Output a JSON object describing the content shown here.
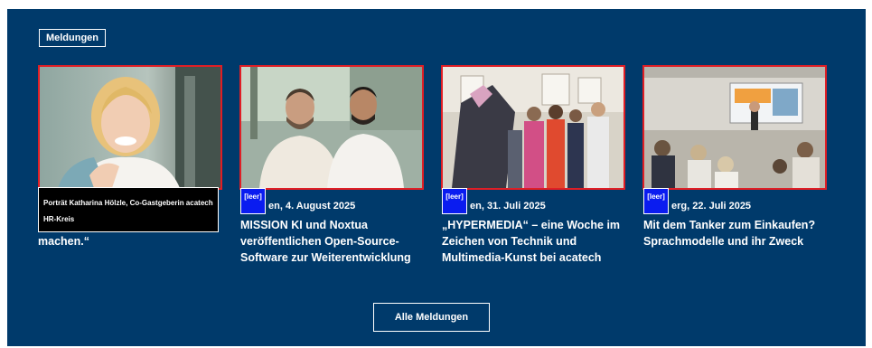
{
  "section": {
    "tag_label": "Meldungen",
    "all_button_label": "Alle Meldungen"
  },
  "cards": [
    {
      "caption_line1": "Porträt Katharina Hölzle, Co-Gastgeberin acatech",
      "caption_line2": "HR-Kreis",
      "title": "machen.“"
    },
    {
      "leer": "[leer]",
      "date": "en, 4. August 2025",
      "title": "MISSION KI und Noxtua veröffentlichen Open-Source-Software zur Weiterentwicklung"
    },
    {
      "leer": "[leer]",
      "date": "en, 31. Juli 2025",
      "title": "„HYPERMEDIA“ – eine Woche im Zeichen von Technik und Multimedia-Kunst bei acatech"
    },
    {
      "leer": "[leer]",
      "date": "erg, 22. Juli 2025",
      "title": "Mit dem Tanker zum Einkaufen? Sprachmodelle und ihr Zweck"
    }
  ],
  "colors": {
    "panel": "#003a6b",
    "image_border": "#e01e25",
    "leer_badge": "#0a1cf0"
  }
}
